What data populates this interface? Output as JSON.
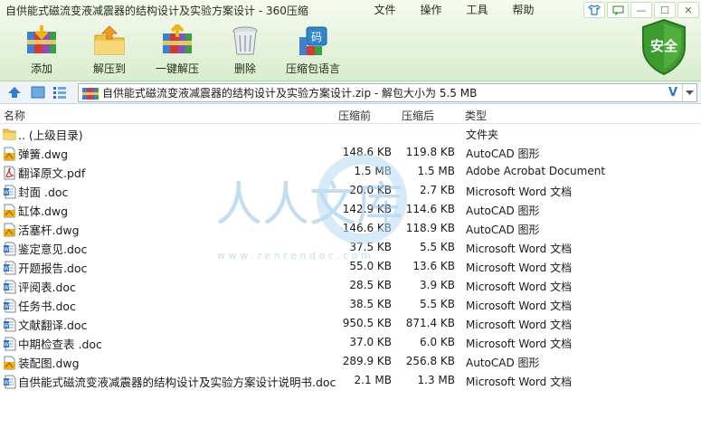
{
  "window": {
    "title": "自供能式磁流变液减震器的结构设计及实验方案设计 - 360压缩"
  },
  "menu": [
    "文件",
    "操作",
    "工具",
    "帮助"
  ],
  "window_buttons": {
    "skin": "skin-icon",
    "feedback": "feedback-icon",
    "minimize": "—",
    "maximize": "☐",
    "close": "✕"
  },
  "toolbar": [
    {
      "label": "添加",
      "icon": "add-archive-icon"
    },
    {
      "label": "解压到",
      "icon": "extract-to-icon"
    },
    {
      "label": "一键解压",
      "icon": "one-click-extract-icon"
    },
    {
      "label": "删除",
      "icon": "delete-bin-icon"
    },
    {
      "label": "压缩包语言",
      "icon": "archive-language-icon"
    }
  ],
  "security_badge": "安全",
  "address": {
    "text": "自供能式磁流变液减震器的结构设计及实验方案设计.zip - 解包大小为 5.5 MB"
  },
  "columns": {
    "name": "名称",
    "original": "压缩前",
    "compressed": "压缩后",
    "type": "类型"
  },
  "files": [
    {
      "name": ".. (上级目录)",
      "original": "",
      "compressed": "",
      "type": "文件夹",
      "icon": "folder"
    },
    {
      "name": "弹簧.dwg",
      "original": "148.6 KB",
      "compressed": "119.8 KB",
      "type": "AutoCAD 图形",
      "icon": "dwg"
    },
    {
      "name": "翻译原文.pdf",
      "original": "1.5 MB",
      "compressed": "1.5 MB",
      "type": "Adobe Acrobat Document",
      "icon": "pdf"
    },
    {
      "name": "封面 .doc",
      "original": "20.0 KB",
      "compressed": "2.7 KB",
      "type": "Microsoft Word 文档",
      "icon": "doc"
    },
    {
      "name": "缸体.dwg",
      "original": "142.9 KB",
      "compressed": "114.6 KB",
      "type": "AutoCAD 图形",
      "icon": "dwg"
    },
    {
      "name": "活塞杆.dwg",
      "original": "146.6 KB",
      "compressed": "118.9 KB",
      "type": "AutoCAD 图形",
      "icon": "dwg"
    },
    {
      "name": "鉴定意见.doc",
      "original": "37.5 KB",
      "compressed": "5.5 KB",
      "type": "Microsoft Word 文档",
      "icon": "doc"
    },
    {
      "name": "开题报告.doc",
      "original": "55.0 KB",
      "compressed": "13.6 KB",
      "type": "Microsoft Word 文档",
      "icon": "doc"
    },
    {
      "name": "评阅表.doc",
      "original": "28.5 KB",
      "compressed": "3.9 KB",
      "type": "Microsoft Word 文档",
      "icon": "doc"
    },
    {
      "name": "任务书.doc",
      "original": "38.5 KB",
      "compressed": "5.5 KB",
      "type": "Microsoft Word 文档",
      "icon": "doc"
    },
    {
      "name": "文献翻译.doc",
      "original": "950.5 KB",
      "compressed": "871.4 KB",
      "type": "Microsoft Word 文档",
      "icon": "doc"
    },
    {
      "name": "中期检查表 .doc",
      "original": "37.0 KB",
      "compressed": "6.0 KB",
      "type": "Microsoft Word 文档",
      "icon": "doc"
    },
    {
      "name": "装配图.dwg",
      "original": "289.9 KB",
      "compressed": "256.8 KB",
      "type": "AutoCAD 图形",
      "icon": "dwg"
    },
    {
      "name": "自供能式磁流变液减震器的结构设计及实验方案设计说明书.doc",
      "original": "2.1 MB",
      "compressed": "1.3 MB",
      "type": "Microsoft Word 文档",
      "icon": "doc"
    }
  ],
  "watermark": {
    "text": "人人文库",
    "url": "w w w . r e n r e n d o c . c o m"
  },
  "colors": {
    "accent_green": "#3c9a2e",
    "selection_blue": "#3574b8",
    "watermark": "#8fc3e8"
  }
}
